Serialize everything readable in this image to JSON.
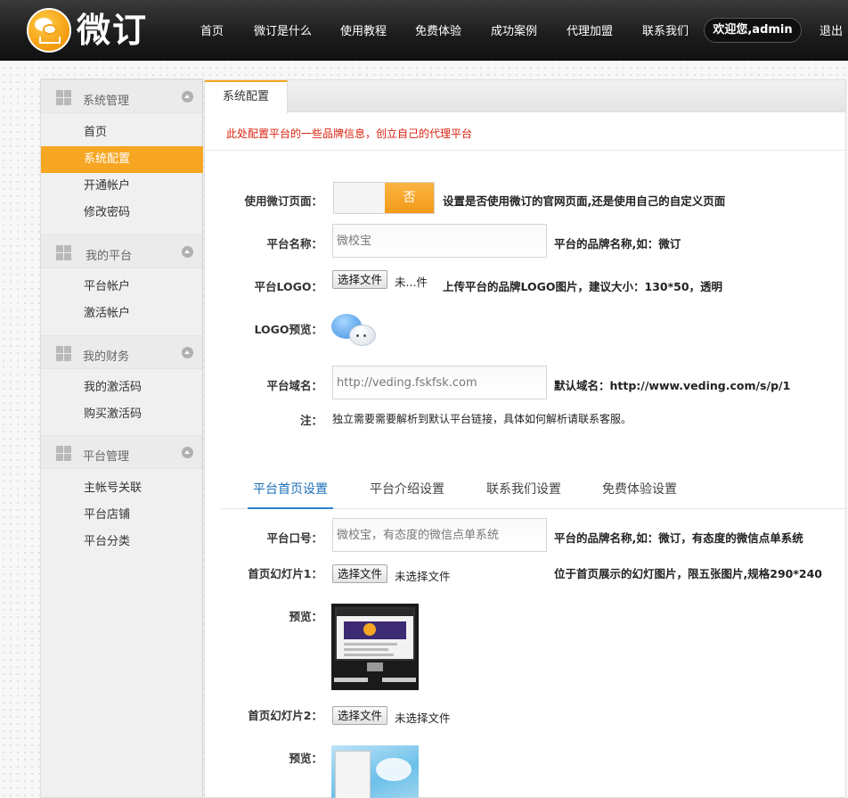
{
  "brand": {
    "logo_text": "微订",
    "accent_color": "#f6a623",
    "link_color": "#1b6fb8",
    "notice_color": "#d9230f"
  },
  "nav": {
    "items": [
      "首页",
      "微订是什么",
      "使用教程",
      "免费体验",
      "成功案例",
      "代理加盟",
      "联系我们"
    ],
    "welcome": "欢迎您,admin",
    "logout": "退出"
  },
  "sidebar": {
    "groups": [
      {
        "title": "系统管理",
        "items": [
          "首页",
          "系统配置",
          "开通帐户",
          "修改密码"
        ]
      },
      {
        "title": "我的平台",
        "items": [
          "平台帐户",
          "激活帐户"
        ]
      },
      {
        "title": "我的财务",
        "items": [
          "我的激活码",
          "购买激活码"
        ]
      },
      {
        "title": "平台管理",
        "items": [
          "主帐号关联",
          "平台店铺",
          "平台分类"
        ]
      }
    ],
    "active_item": "系统配置"
  },
  "panel": {
    "tab": "系统配置",
    "notice": "此处配置平台的一些品牌信息，创立自己的代理平台"
  },
  "form": {
    "use_page": {
      "label": "使用微订页面：",
      "toggle_value": "否",
      "desc": "设置是否使用微订的官网页面,还是使用自己的自定义页面"
    },
    "platform_name": {
      "label": "平台名称：",
      "placeholder": "微校宝",
      "desc": "平台的品牌名称,如：微订"
    },
    "platform_logo": {
      "label": "平台LOGO：",
      "button": "选择文件",
      "status": "未...件",
      "desc": "上传平台的品牌LOGO图片，建议大小：130*50，透明"
    },
    "logo_preview": {
      "label": "LOGO预览："
    },
    "platform_domain": {
      "label": "平台域名：",
      "placeholder": "http://veding.fskfsk.com",
      "desc": "默认域名：http://www.veding.com/s/p/1"
    },
    "note": {
      "label": "注：",
      "text": "独立需要需要解析到默认平台链接，具体如何解析请联系客服。"
    }
  },
  "subtabs": [
    "平台首页设置",
    "平台介绍设置",
    "联系我们设置",
    "免费体验设置"
  ],
  "homepage_settings": {
    "slogan": {
      "label": "平台口号：",
      "placeholder": "微校宝，有态度的微信点单系统",
      "desc": "平台的品牌名称,如：微订，有态度的微信点单系统"
    },
    "slide1": {
      "label": "首页幻灯片1：",
      "button": "选择文件",
      "status": "未选择文件",
      "desc": "位于首页展示的幻灯图片，限五张图片,规格290*240"
    },
    "preview1": {
      "label": "预览："
    },
    "slide2": {
      "label": "首页幻灯片2：",
      "button": "选择文件",
      "status": "未选择文件"
    },
    "preview2": {
      "label": "预览："
    }
  }
}
